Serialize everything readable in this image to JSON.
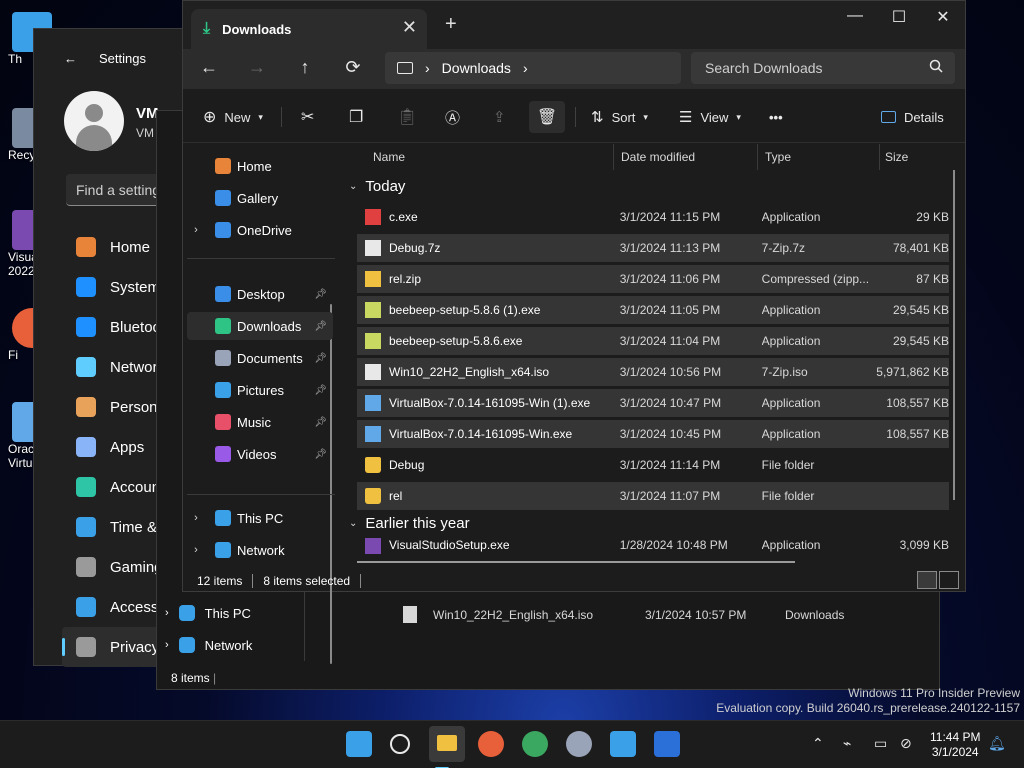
{
  "desktop": {
    "icons": [
      {
        "label": "Th"
      },
      {
        "label": "Recy"
      },
      {
        "label": "Visua\n2022"
      },
      {
        "label": "Fi"
      },
      {
        "label": "Orac\nVirtu"
      }
    ]
  },
  "settings": {
    "title": "Settings",
    "user_name": "VM",
    "user_sub": "VM",
    "find_placeholder": "Find a setting",
    "nav": [
      {
        "label": "Home",
        "icon": "home-icon",
        "color": "#e8833a"
      },
      {
        "label": "System",
        "icon": "system-icon",
        "color": "#1e90ff"
      },
      {
        "label": "Bluetoo",
        "icon": "bluetooth-icon",
        "color": "#1e90ff"
      },
      {
        "label": "Networ",
        "icon": "network-icon",
        "color": "#60cdff"
      },
      {
        "label": "Persona",
        "icon": "brush-icon",
        "color": "#e8a25a"
      },
      {
        "label": "Apps",
        "icon": "apps-icon",
        "color": "#8ab4f8"
      },
      {
        "label": "Account",
        "icon": "account-icon",
        "color": "#2ec4a6"
      },
      {
        "label": "Time &",
        "icon": "clock-icon",
        "color": "#3aa0e8"
      },
      {
        "label": "Gaming",
        "icon": "gaming-icon",
        "color": "#9a9a9a"
      },
      {
        "label": "Accessi",
        "icon": "accessibility-icon",
        "color": "#3aa0e8"
      },
      {
        "label": "Privacy",
        "icon": "shield-icon",
        "color": "#9a9a9a"
      }
    ]
  },
  "explorer_back": {
    "nav": [
      {
        "label": "This PC"
      },
      {
        "label": "Network"
      }
    ],
    "file": {
      "name": "Win10_22H2_English_x64.iso",
      "date": "3/1/2024 10:57 PM",
      "location": "Downloads"
    },
    "status": "8 items"
  },
  "explorer": {
    "tab_title": "Downloads",
    "new_tab": "+",
    "breadcrumb": "Downloads",
    "search_placeholder": "Search Downloads",
    "toolbar": {
      "new_label": "New",
      "sort_label": "Sort",
      "view_label": "View",
      "more_label": "•••",
      "details_label": "Details"
    },
    "nav_pane": {
      "top": [
        {
          "label": "Home",
          "icon": "home-icon",
          "color": "#e8833a",
          "chevron": ""
        },
        {
          "label": "Gallery",
          "icon": "gallery-icon",
          "color": "#3a8ee8",
          "chevron": ""
        },
        {
          "label": "OneDrive",
          "icon": "onedrive-icon",
          "color": "#3a8ee8",
          "chevron": "›"
        }
      ],
      "pinned": [
        {
          "label": "Desktop",
          "icon": "desktop-icon",
          "color": "#3a8ee8"
        },
        {
          "label": "Downloads",
          "icon": "downloads-icon",
          "color": "#2ec486"
        },
        {
          "label": "Documents",
          "icon": "documents-icon",
          "color": "#9aa4b8"
        },
        {
          "label": "Pictures",
          "icon": "pictures-icon",
          "color": "#3aa0e8"
        },
        {
          "label": "Music",
          "icon": "music-icon",
          "color": "#e8506a"
        },
        {
          "label": "Videos",
          "icon": "videos-icon",
          "color": "#9a5ae8"
        }
      ],
      "bottom": [
        {
          "label": "This PC",
          "icon": "pc-icon",
          "color": "#3aa0e8"
        },
        {
          "label": "Network",
          "icon": "network-icon",
          "color": "#3aa0e8"
        }
      ]
    },
    "columns": {
      "name": "Name",
      "date": "Date modified",
      "type": "Type",
      "size": "Size"
    },
    "groups": {
      "today": "Today",
      "earlier": "Earlier this year"
    },
    "files": [
      {
        "name": "c.exe",
        "date": "3/1/2024 11:15 PM",
        "type": "Application",
        "size": "29 KB",
        "icon": "exe-icon",
        "color": "#e04040",
        "selected": false
      },
      {
        "name": "Debug.7z",
        "date": "3/1/2024 11:13 PM",
        "type": "7-Zip.7z",
        "size": "78,401 KB",
        "icon": "file-icon",
        "color": "#e8e8e8",
        "selected": true
      },
      {
        "name": "rel.zip",
        "date": "3/1/2024 11:06 PM",
        "type": "Compressed (zipp...",
        "size": "87 KB",
        "icon": "zip-icon",
        "color": "#f0c040",
        "selected": true
      },
      {
        "name": "beebeep-setup-5.8.6 (1).exe",
        "date": "3/1/2024 11:05 PM",
        "type": "Application",
        "size": "29,545 KB",
        "icon": "bee-icon",
        "color": "#c8d860",
        "selected": true
      },
      {
        "name": "beebeep-setup-5.8.6.exe",
        "date": "3/1/2024 11:04 PM",
        "type": "Application",
        "size": "29,545 KB",
        "icon": "bee-icon",
        "color": "#c8d860",
        "selected": true
      },
      {
        "name": "Win10_22H2_English_x64.iso",
        "date": "3/1/2024 10:56 PM",
        "type": "7-Zip.iso",
        "size": "5,971,862 KB",
        "icon": "file-icon",
        "color": "#e8e8e8",
        "selected": true
      },
      {
        "name": "VirtualBox-7.0.14-161095-Win (1).exe",
        "date": "3/1/2024 10:47 PM",
        "type": "Application",
        "size": "108,557 KB",
        "icon": "virtualbox-icon",
        "color": "#60a8e8",
        "selected": true
      },
      {
        "name": "VirtualBox-7.0.14-161095-Win.exe",
        "date": "3/1/2024 10:45 PM",
        "type": "Application",
        "size": "108,557 KB",
        "icon": "virtualbox-icon",
        "color": "#60a8e8",
        "selected": true
      },
      {
        "name": "Debug",
        "date": "3/1/2024 11:14 PM",
        "type": "File folder",
        "size": "",
        "icon": "folder-icon",
        "color": "#f0c040",
        "selected": false
      },
      {
        "name": "rel",
        "date": "3/1/2024 11:07 PM",
        "type": "File folder",
        "size": "",
        "icon": "folder-icon",
        "color": "#f0c040",
        "selected": true
      }
    ],
    "partial_row": {
      "name": "VisualStudioSetup.exe",
      "date": "1/28/2024 10:48 PM",
      "type": "Application",
      "size": "3,099 KB"
    },
    "status_count": "12 items",
    "status_selected": "8 items selected"
  },
  "watermark": {
    "line1": "Windows 11 Pro Insider Preview",
    "line2": "Evaluation copy. Build 26040.rs_prerelease.240122-1157"
  },
  "taskbar": {
    "time": "11:44 PM",
    "date": "3/1/2024",
    "apps": [
      {
        "icon": "start-icon",
        "color": "#3aa0e8"
      },
      {
        "icon": "search-icon",
        "color": "#e8e8e8"
      },
      {
        "icon": "file-explorer-icon",
        "color": "#f0c040"
      },
      {
        "icon": "firefox-icon",
        "color": "#e8603a"
      },
      {
        "icon": "chrome-icon",
        "color": "#3aa860"
      },
      {
        "icon": "settings-icon",
        "color": "#9aa4b8"
      },
      {
        "icon": "notepad-icon",
        "color": "#3aa0e8"
      },
      {
        "icon": "defender-icon",
        "color": "#2a70d8"
      }
    ]
  }
}
